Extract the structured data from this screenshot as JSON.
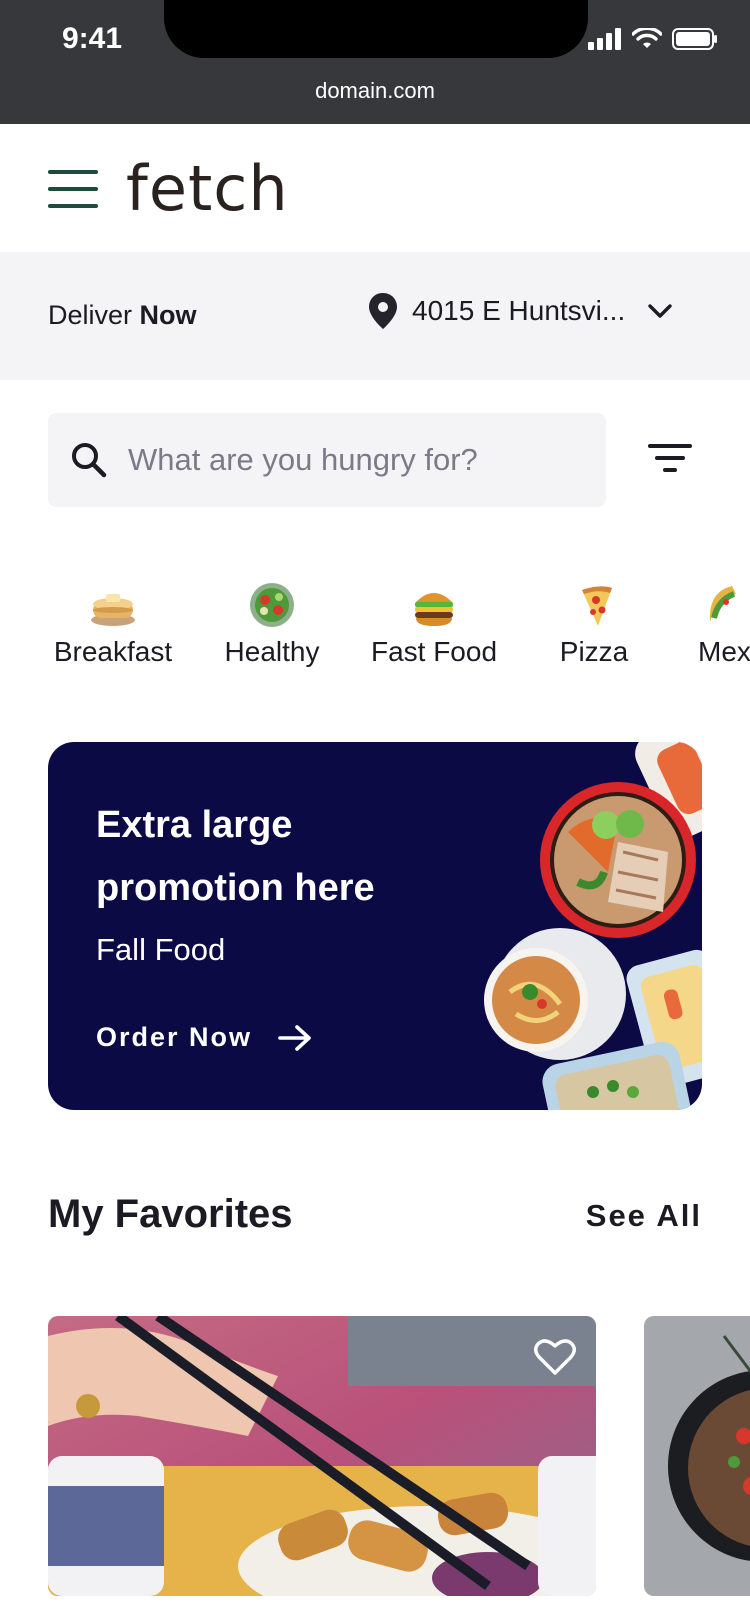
{
  "status_bar": {
    "time": "9:41"
  },
  "browser": {
    "url": "domain.com"
  },
  "header": {
    "logo": "fetch"
  },
  "deliver": {
    "label": "Deliver",
    "mode": "Now",
    "address": "4015 E Huntsvi..."
  },
  "search": {
    "placeholder": "What are you hungry for?"
  },
  "categories": [
    {
      "label": "Breakfast",
      "icon": "pancakes-icon"
    },
    {
      "label": "Healthy",
      "icon": "salad-icon"
    },
    {
      "label": "Fast Food",
      "icon": "burger-icon"
    },
    {
      "label": "Pizza",
      "icon": "pizza-icon"
    },
    {
      "label": "Mex",
      "icon": "taco-icon"
    }
  ],
  "promo": {
    "title": "Extra large promotion here",
    "subtitle": "Fall Food",
    "cta": "Order Now",
    "background": "#0b0a45"
  },
  "favorites": {
    "title": "My Favorites",
    "see_all": "See All"
  },
  "colors": {
    "accent": "#1f4a3d",
    "chrome": "#36383b",
    "surface": "#f4f4f6"
  }
}
